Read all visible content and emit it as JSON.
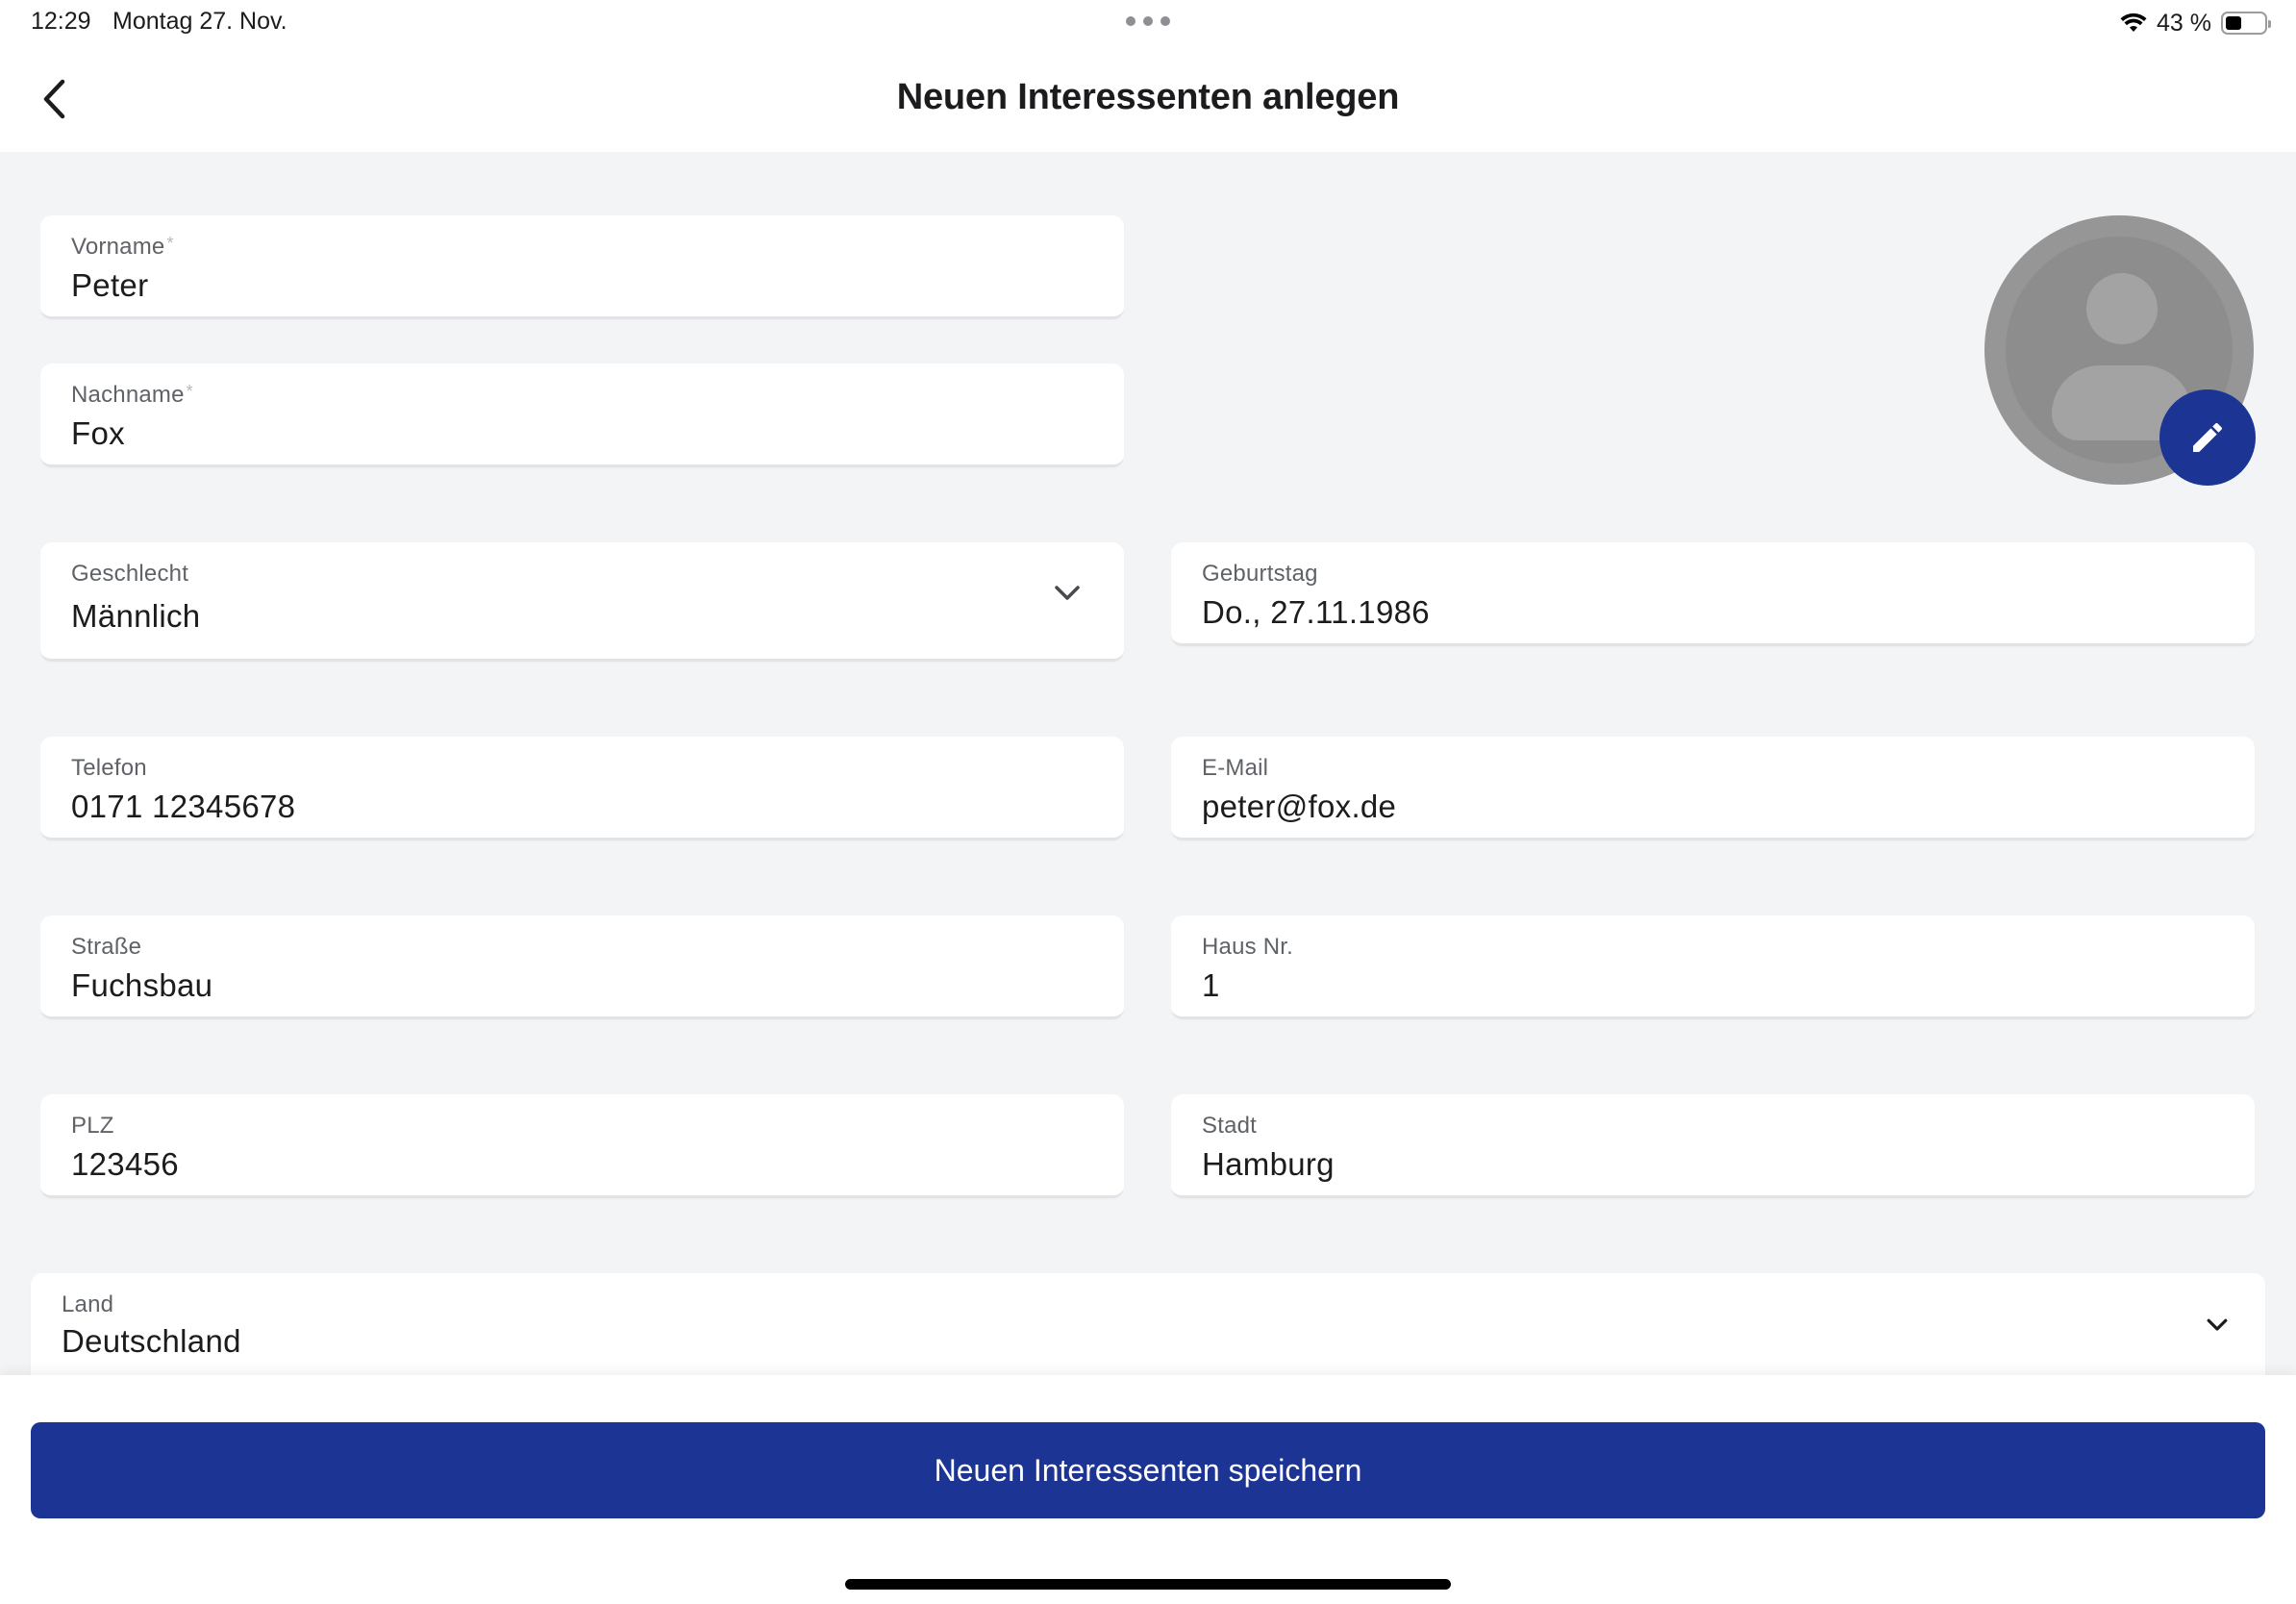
{
  "status_bar": {
    "time": "12:29",
    "date": "Montag 27. Nov.",
    "battery_text": "43 %",
    "battery_level_percent": 43
  },
  "header": {
    "title": "Neuen Interessenten anlegen",
    "back_icon": "chevron-left-icon"
  },
  "form": {
    "vorname": {
      "label": "Vorname",
      "required_mark": "*",
      "value": "Peter"
    },
    "nachname": {
      "label": "Nachname",
      "required_mark": "*",
      "value": "Fox"
    },
    "geschlecht": {
      "label": "Geschlecht",
      "value": "Männlich"
    },
    "geburtstag": {
      "label": "Geburtstag",
      "value": "Do., 27.11.1986"
    },
    "telefon": {
      "label": "Telefon",
      "value": "0171 12345678"
    },
    "email": {
      "label": "E-Mail",
      "value": "peter@fox.de"
    },
    "strasse": {
      "label": "Straße",
      "value": "Fuchsbau"
    },
    "hausnr": {
      "label": "Haus Nr.",
      "value": "1"
    },
    "plz": {
      "label": "PLZ",
      "value": "123456"
    },
    "stadt": {
      "label": "Stadt",
      "value": "Hamburg"
    },
    "land": {
      "label": "Land",
      "value": "Deutschland"
    }
  },
  "avatar": {
    "icon": "person-placeholder-icon",
    "edit_icon": "pencil-icon"
  },
  "actions": {
    "save_label": "Neuen Interessenten speichern"
  },
  "colors": {
    "primary": "#1c3494",
    "background": "#f3f4f6",
    "field_bg": "#ffffff"
  }
}
